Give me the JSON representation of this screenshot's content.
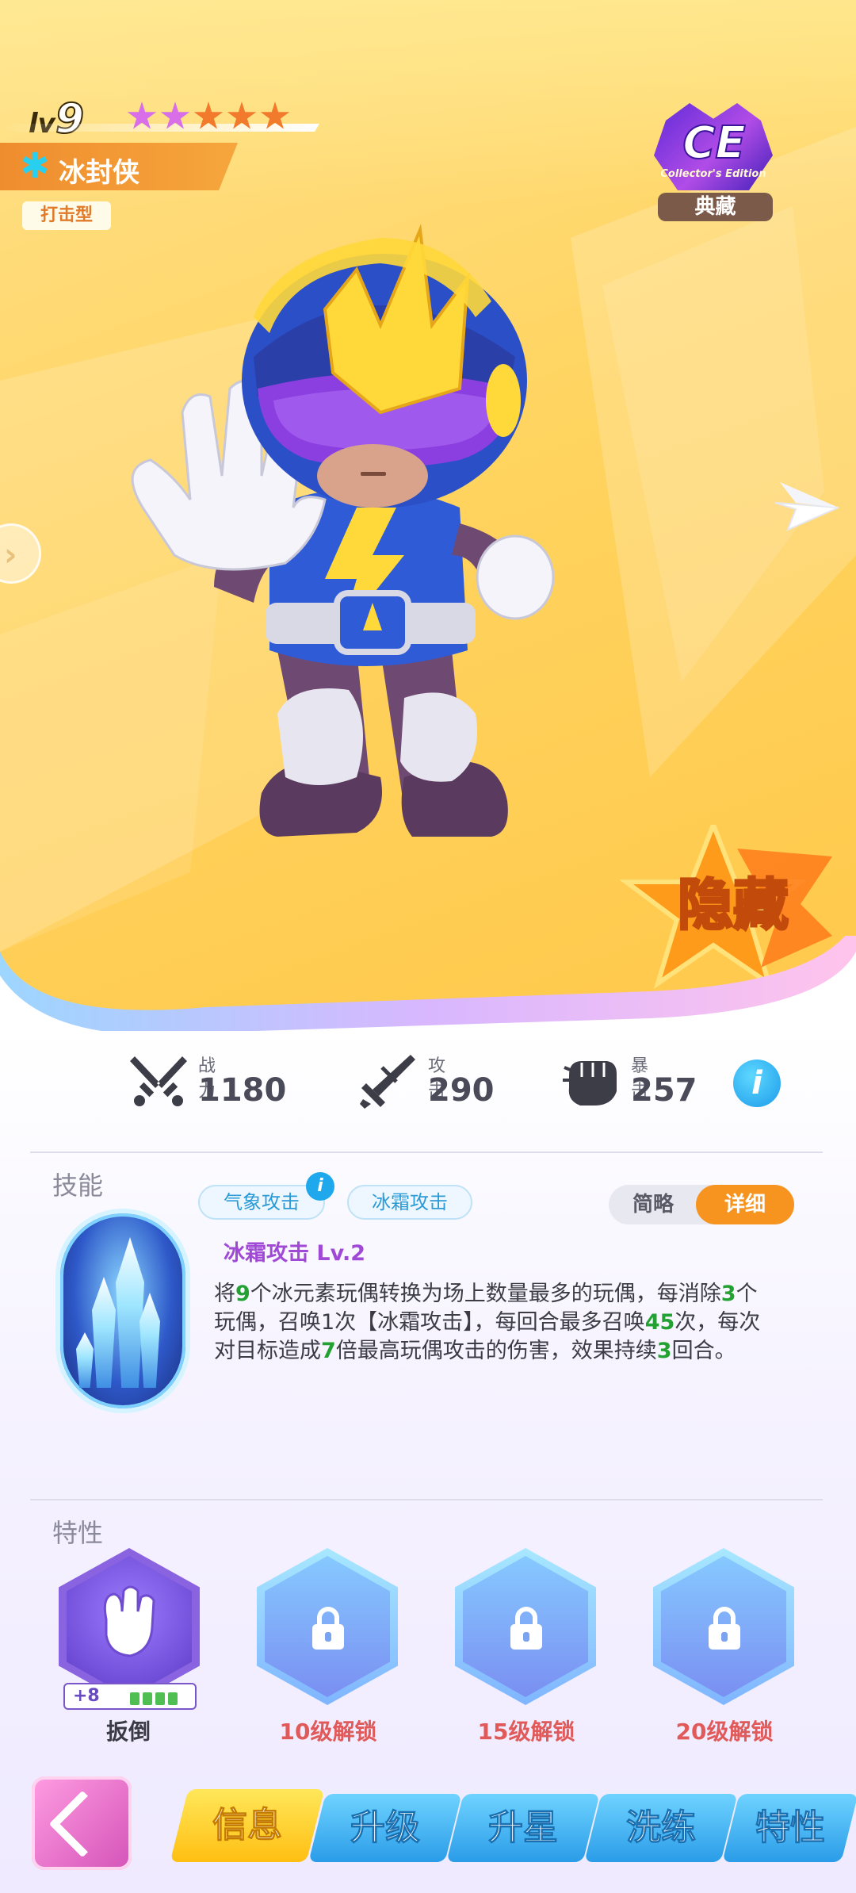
{
  "hero": {
    "level_prefix": "lv",
    "level": "9",
    "stars": [
      "pink",
      "pink",
      "orange",
      "orange",
      "orange"
    ],
    "name": "冰封侠",
    "type": "打击型",
    "edition_letters": "CE",
    "edition_subtitle": "Collector's Edition",
    "edition_label": "典藏",
    "rarity_badge": "隐藏"
  },
  "stats": [
    {
      "label": "战力",
      "value": "1180",
      "icon": "crossed-swords-icon"
    },
    {
      "label": "攻击",
      "value": "290",
      "icon": "sword-icon"
    },
    {
      "label": "暴击",
      "value": "257",
      "icon": "fist-icon"
    }
  ],
  "info_icon": "i",
  "skill": {
    "section_title": "技能",
    "tags": [
      "气象攻击",
      "冰霜攻击"
    ],
    "tag_info_icon": "i",
    "toggle_brief": "简略",
    "toggle_detail": "详细",
    "name": "冰霜攻击 Lv.2",
    "desc_parts": [
      "将",
      "9",
      "个冰元素玩偶转换为场上数量最多的玩偶，每消除",
      "3",
      "个玩偶，召唤1次【冰霜攻击】，每回合最多召唤",
      "45",
      "次，每次对目标造成",
      "7",
      "倍最高玩偶攻击的伤害，效果持续",
      "3",
      "回合。"
    ]
  },
  "traits": {
    "section_title": "特性",
    "items": [
      {
        "label": "扳倒",
        "level": "+8",
        "level_fill": 4,
        "locked": false
      },
      {
        "label": "10级解锁",
        "locked": true
      },
      {
        "label": "15级解锁",
        "locked": true
      },
      {
        "label": "20级解锁",
        "locked": true
      }
    ]
  },
  "nav": {
    "tabs": [
      "信息",
      "升级",
      "升星",
      "洗练",
      "特性"
    ],
    "active": "信息"
  },
  "colors": {
    "hero_bg": "#ffd460",
    "accent_orange": "#f7941f",
    "locked_text": "#e05a5a",
    "skill_name": "#a049d6",
    "highlight_green": "#23a233"
  }
}
